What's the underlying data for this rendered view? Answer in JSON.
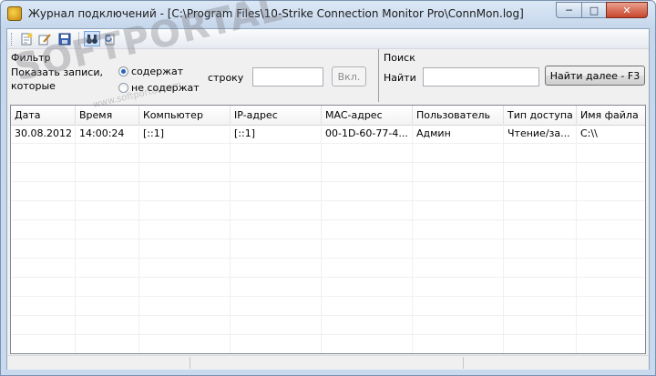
{
  "window": {
    "title": "Журнал подключений - [C:\\Program Files\\10-Strike Connection Monitor Pro\\ConnMon.log]",
    "minimize_glyph": "─",
    "maximize_glyph": "□",
    "close_glyph": "✕"
  },
  "toolbar": {
    "buttons": [
      {
        "icon": "new-document-icon",
        "glyph": "📄"
      },
      {
        "icon": "clear-log-icon",
        "glyph": "🧹"
      },
      {
        "icon": "save-icon",
        "glyph": "💾"
      },
      {
        "icon": "binoculars-icon",
        "glyph": "🔍"
      },
      {
        "icon": "refresh-icon",
        "glyph": "↻"
      }
    ]
  },
  "filter": {
    "title": "Фильтр",
    "show_records_line1": "Показать записи,",
    "show_records_line2": "которые",
    "option_contains": "содержат",
    "option_not_contains": "не содержат",
    "selected": "содержат",
    "string_label": "строку",
    "string_value": "",
    "apply_button": "Вкл."
  },
  "search": {
    "title": "Поиск",
    "find_label": "Найти",
    "find_value": "",
    "find_next_button": "Найти далее - F3"
  },
  "table": {
    "columns": [
      "Дата",
      "Время",
      "Компьютер",
      "IP-адрес",
      "MAC-адрес",
      "Пользователь",
      "Тип доступа",
      "Имя файла"
    ],
    "rows": [
      [
        "30.08.2012",
        "14:00:24",
        "[::1]",
        "[::1]",
        "00-1D-60-77-4...",
        "Админ",
        "Чтение/за...",
        "C:\\\\"
      ]
    ]
  },
  "watermark": {
    "text": "SOFTPORTAL",
    "sub": "www.softportal.com"
  }
}
